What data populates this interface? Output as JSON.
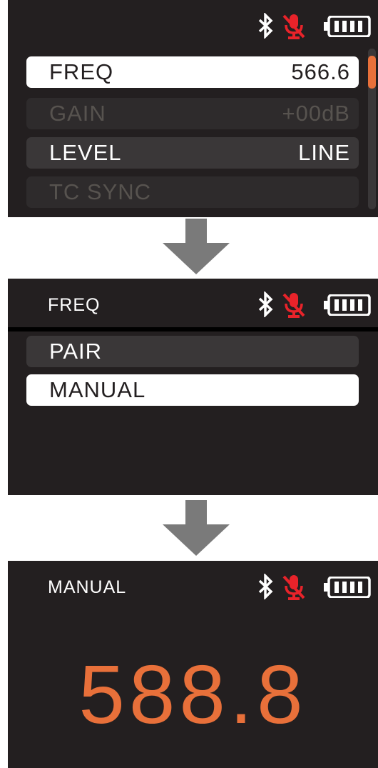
{
  "colors": {
    "screen_bg": "#231f20",
    "accent_orange": "#e8703a",
    "mic_muted_red": "#e8232a",
    "arrow_gray": "#7a7a7a"
  },
  "icons": {
    "bluetooth": "bluetooth-icon",
    "mic": "microphone-muted-icon",
    "battery": "battery-full-icon",
    "arrow": "arrow-down-icon"
  },
  "screen1": {
    "menu": [
      {
        "label": "FREQ",
        "value": "566.6",
        "state": "selected"
      },
      {
        "label": "GAIN",
        "value": "+00dB",
        "state": "disabled"
      },
      {
        "label": "LEVEL",
        "value": "LINE",
        "state": "normal"
      },
      {
        "label": "TC SYNC",
        "value": "",
        "state": "disabled"
      }
    ]
  },
  "screen2": {
    "title": "FREQ",
    "options": [
      {
        "label": "PAIR",
        "state": "normal"
      },
      {
        "label": "MANUAL",
        "state": "selected"
      }
    ]
  },
  "screen3": {
    "title": "MANUAL",
    "frequency": "588.8"
  }
}
